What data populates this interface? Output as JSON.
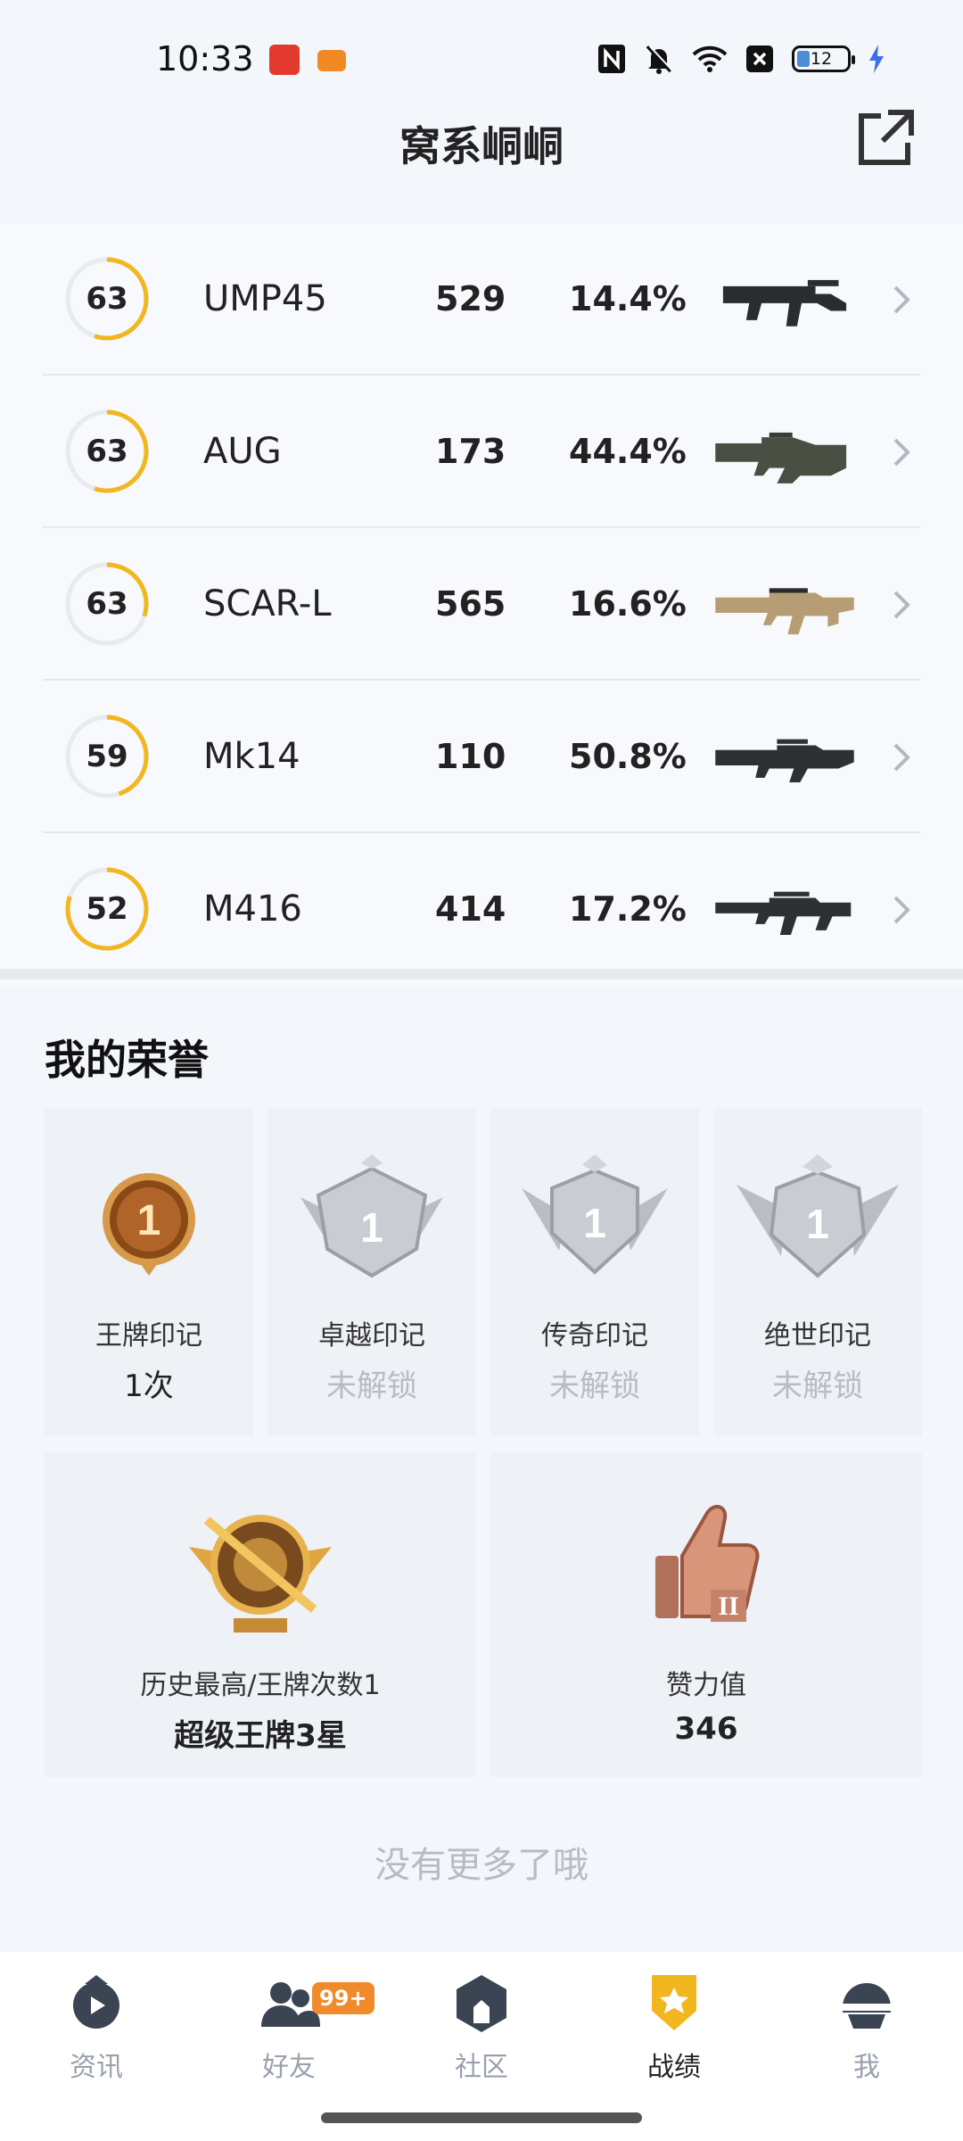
{
  "status_bar": {
    "time": "10:33",
    "battery_level": "12"
  },
  "header": {
    "title": "窝系峒峒",
    "share_icon": "external-share-icon"
  },
  "weapons": [
    {
      "level": "63",
      "name": "UMP45",
      "kills": "529",
      "rate": "14.4%",
      "ring_fraction": 0.55,
      "icon": "smg-ump45-icon"
    },
    {
      "level": "63",
      "name": "AUG",
      "kills": "173",
      "rate": "44.4%",
      "ring_fraction": 0.55,
      "icon": "rifle-aug-icon"
    },
    {
      "level": "63",
      "name": "SCAR-L",
      "kills": "565",
      "rate": "16.6%",
      "ring_fraction": 0.3,
      "icon": "rifle-scarl-icon"
    },
    {
      "level": "59",
      "name": "Mk14",
      "kills": "110",
      "rate": "50.8%",
      "ring_fraction": 0.45,
      "icon": "dmr-mk14-icon"
    },
    {
      "level": "52",
      "name": "M416",
      "kills": "414",
      "rate": "17.2%",
      "ring_fraction": 0.8,
      "icon": "rifle-m416-icon"
    }
  ],
  "honors": {
    "title": "我的荣誉",
    "marks": [
      {
        "label": "王牌印记",
        "value": "1次",
        "locked": false,
        "badge_number": "1"
      },
      {
        "label": "卓越印记",
        "value": "未解锁",
        "locked": true,
        "badge_number": "1"
      },
      {
        "label": "传奇印记",
        "value": "未解锁",
        "locked": true,
        "badge_number": "1"
      },
      {
        "label": "绝世印记",
        "value": "未解锁",
        "locked": true,
        "badge_number": "1"
      }
    ],
    "highest": {
      "label": "历史最高/王牌次数1",
      "value": "超级王牌3星"
    },
    "likes": {
      "label": "赞力值",
      "value": "346"
    }
  },
  "end_text": "没有更多了哦",
  "nav": {
    "items": [
      {
        "label": "资讯",
        "icon": "news-icon",
        "active": false
      },
      {
        "label": "好友",
        "icon": "friends-icon",
        "active": false,
        "badge": "99+"
      },
      {
        "label": "社区",
        "icon": "community-icon",
        "active": false
      },
      {
        "label": "战绩",
        "icon": "record-icon",
        "active": true
      },
      {
        "label": "我",
        "icon": "profile-icon",
        "active": false
      }
    ]
  },
  "colors": {
    "accent": "#f2b61f",
    "ring_track": "#e7eaef",
    "badge": "#f08a2a"
  }
}
